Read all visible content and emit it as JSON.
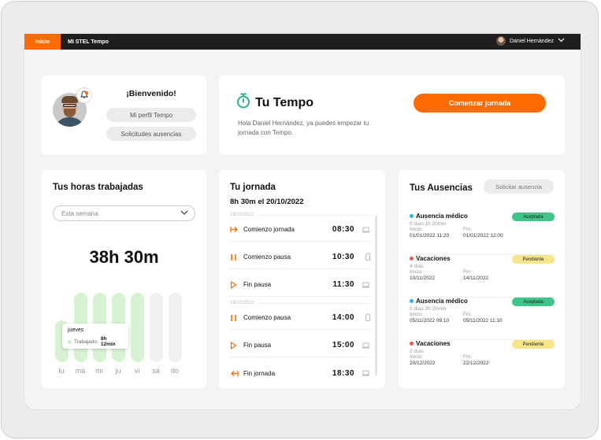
{
  "topbar": {
    "tab": "Inicio",
    "app_name": "MI STEL Tempo",
    "user_name": "Daniel Hernández"
  },
  "colors": {
    "brand": "#ff6b00",
    "accepted": "#3fc48a",
    "pending": "#f7e58a",
    "blue_dot": "#27b6e0",
    "red_dot": "#ef5b52",
    "bar": "#d8f3d3"
  },
  "welcome": {
    "title": "¡Bienvenido!",
    "profile_btn": "Mi perfil Tempo",
    "requests_btn": "Solicitudes ausencias"
  },
  "tempo": {
    "title": "Tu Tempo",
    "text": "Hola Daniel Hernández, ya puedes empezar tu jornada con Tempo.",
    "cta": "Comenzar jornada"
  },
  "horas": {
    "title": "Tus horas trabajadas",
    "period": "Esta semana",
    "total": "38h 30m",
    "days": [
      "lu",
      "ma",
      "mi",
      "ju",
      "vi",
      "sá",
      "do"
    ],
    "values": [
      0.6,
      1.0,
      1.0,
      1.0,
      1.0,
      1.0,
      1.0
    ],
    "tooltip": {
      "day": "jueves",
      "label": "Trabajado:",
      "value": "8h 12min"
    }
  },
  "jornada": {
    "title": "Tu jornada",
    "subtitle": "8h 30m el 20/10/2022",
    "groups": [
      {
        "date": "19/10/2022",
        "rows": [
          {
            "label": "Comienzo jornada",
            "time": "08:30"
          },
          {
            "label": "Comienzo pausa",
            "time": "10:30"
          },
          {
            "label": "Fin pausa",
            "time": "11:30"
          }
        ]
      },
      {
        "date": "19/10/2022",
        "rows": [
          {
            "label": "Comienzo pausa",
            "time": "14:00"
          },
          {
            "label": "Fin pausa",
            "time": "15:00"
          },
          {
            "label": "Fin jornada",
            "time": "18:30"
          }
        ]
      }
    ]
  },
  "ausencias": {
    "title": "Tus Ausencias",
    "request_btn": "Solicitar ausencia",
    "start_label": "Inicio:",
    "end_label": "Fin:",
    "items": [
      {
        "name": "Ausencia médico",
        "duration": "0 días 1h 20min",
        "start": "01/01/2022 11:20",
        "end": "01/01/2022 12:00",
        "status": "Aceptada"
      },
      {
        "name": "Vacaciones",
        "duration": "4 días",
        "start": "10/11/2022",
        "end": "14/11/2022",
        "status": "Pendiente"
      },
      {
        "name": "Ausencia médico",
        "duration": "0 días 2h 20min",
        "start": "05/11/2022 09:10",
        "end": "05/11/2022 11:10",
        "status": "Aceptada"
      },
      {
        "name": "Vacaciones",
        "duration": "2 días",
        "start": "20/12/2022",
        "end": "22/12/2022",
        "status": "Pendiente"
      }
    ]
  }
}
